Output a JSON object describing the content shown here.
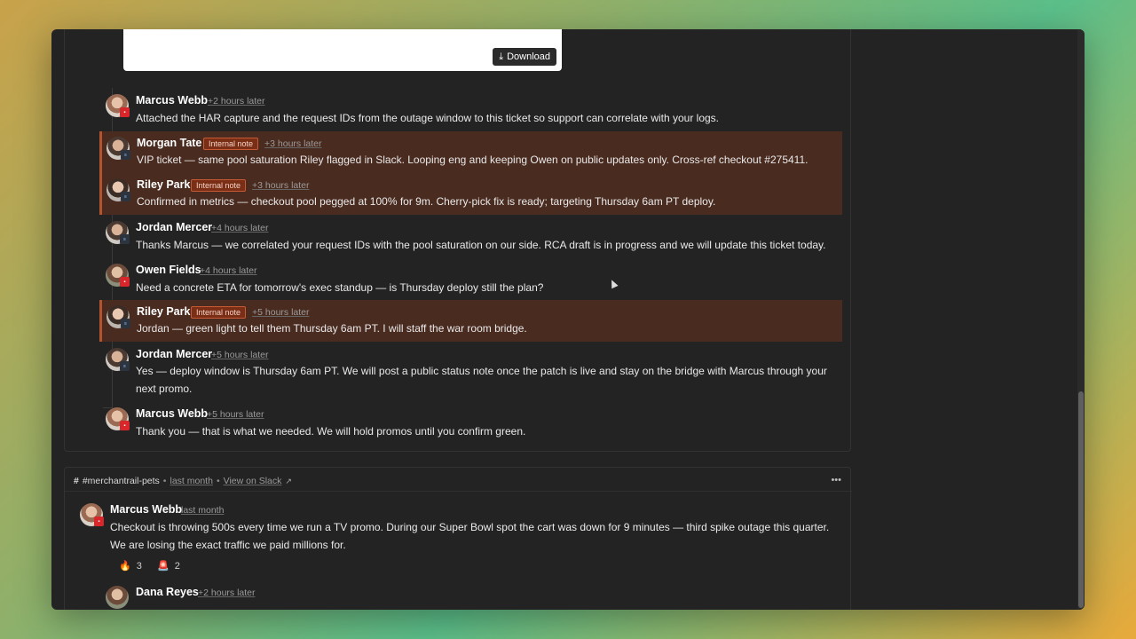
{
  "attachment": {
    "download_label": "Download"
  },
  "thread": [
    {
      "name": "Marcus Webb",
      "time": "+2 hours later",
      "internal": false,
      "text": "Attached the HAR capture and the request IDs from the outage window to this ticket so support can correlate with your logs."
    },
    {
      "name": "Morgan Tate",
      "time": "+3 hours later",
      "internal": true,
      "tag": "Internal note",
      "text": "VIP ticket — same pool saturation Riley flagged in Slack. Looping eng and keeping Owen on public updates only. Cross-ref checkout #275411."
    },
    {
      "name": "Riley Park",
      "time": "+3 hours later",
      "internal": true,
      "tag": "Internal note",
      "text": "Confirmed in metrics — checkout pool pegged at 100% for 9m. Cherry-pick fix is ready; targeting Thursday 6am PT deploy."
    },
    {
      "name": "Jordan Mercer",
      "time": "+4 hours later",
      "internal": false,
      "text": "Thanks Marcus — we correlated your request IDs with the pool saturation on our side. RCA draft is in progress and we will update this ticket today."
    },
    {
      "name": "Owen Fields",
      "time": "+4 hours later",
      "internal": false,
      "text": "Need a concrete ETA for tomorrow's exec standup — is Thursday deploy still the plan?"
    },
    {
      "name": "Riley Park",
      "time": "+5 hours later",
      "internal": true,
      "tag": "Internal note",
      "text": "Jordan — green light to tell them Thursday 6am PT. I will staff the war room bridge."
    },
    {
      "name": "Jordan Mercer",
      "time": "+5 hours later",
      "internal": false,
      "text_line1": "Yes — deploy window is Thursday 6am PT. We will post a public status note once the patch is live and stay on the bridge with Marcus through your",
      "text_line2": "next promo."
    },
    {
      "name": "Marcus Webb",
      "time": "+5 hours later",
      "internal": false,
      "text": "Thank you — that is what we needed. We will hold promos until you confirm green."
    }
  ],
  "channel": {
    "name": "#merchantrail-pets",
    "time": "last month",
    "view_link": "View on Slack",
    "more": "•••",
    "messages": [
      {
        "name": "Marcus Webb",
        "time": "last month",
        "text_line1": "Checkout is throwing 500s every time we run a TV promo. During our Super Bowl spot the cart was down for 9 minutes — third spike outage this quarter.",
        "text_line2": "We are losing the exact traffic we paid millions for.",
        "reactions": [
          {
            "icon": "fire-icon",
            "glyph": "🔥",
            "count": "3"
          },
          {
            "icon": "siren-icon",
            "glyph": "🚨",
            "count": "2"
          }
        ]
      },
      {
        "name": "Dana Reyes",
        "time": "+2 hours later"
      }
    ]
  },
  "colors": {
    "internal_bg": "#4a2b20",
    "internal_border": "#b4542e",
    "tag_bg": "#7a2e16"
  }
}
